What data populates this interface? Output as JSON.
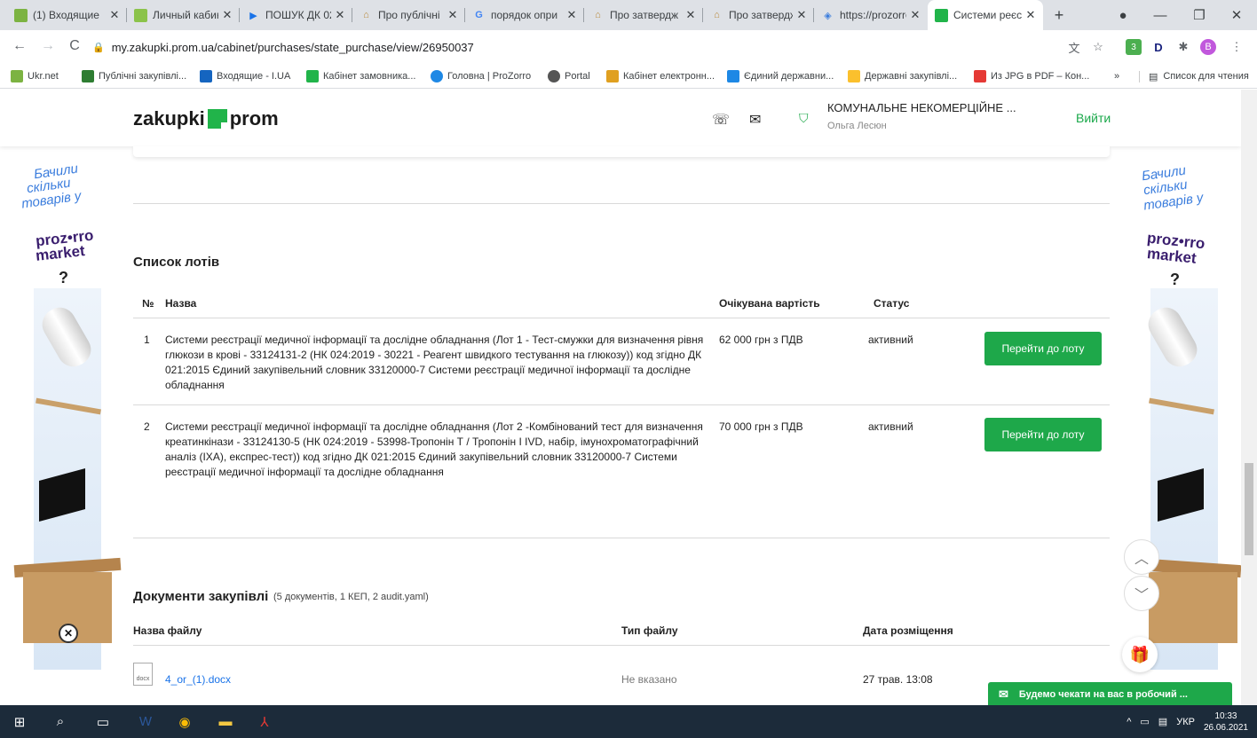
{
  "browser": {
    "tabs": [
      {
        "title": "(1) Входящие",
        "favicon_color": "#7cb342",
        "active": false
      },
      {
        "title": "Личный кабин",
        "favicon_color": "#8bc34a",
        "active": false
      },
      {
        "title": "ПОШУК ДК 02",
        "favicon_color": "#1a73e8",
        "active": false
      },
      {
        "title": "Про публічні",
        "favicon_color": "#b88a3c",
        "active": false
      },
      {
        "title": "порядок опри",
        "favicon_color": "#4285f4",
        "active": false
      },
      {
        "title": "Про затвердж",
        "favicon_color": "#b88a3c",
        "active": false
      },
      {
        "title": "Про затвердж",
        "favicon_color": "#b88a3c",
        "active": false
      },
      {
        "title": "https://prozorro",
        "favicon_color": "#3b7ddd",
        "active": false
      },
      {
        "title": "Системи реєс",
        "favicon_color": "#21b44a",
        "active": true
      }
    ],
    "url": "my.zakupki.prom.ua/cabinet/purchases/state_purchase/view/26950037",
    "profile_letter": "B",
    "bookmarks": [
      {
        "label": "Ukr.net",
        "color": "#7cb342"
      },
      {
        "label": "Публічні закупівлі...",
        "color": "#2e7d32"
      },
      {
        "label": "Входящие - I.UA",
        "color": "#1565c0"
      },
      {
        "label": "Кабінет замовника...",
        "color": "#21b44a"
      },
      {
        "label": "Головна | ProZorro",
        "color": "#1e88e5"
      },
      {
        "label": "Portal",
        "color": "#555555"
      },
      {
        "label": "Кабінет електронн...",
        "color": "#e0a020"
      },
      {
        "label": "Єдиний державни...",
        "color": "#1e88e5"
      },
      {
        "label": "Державні закупівлі...",
        "color": "#fbc02d"
      },
      {
        "label": "Из JPG в PDF – Кон...",
        "color": "#e53935"
      }
    ],
    "reading_list": "Список для чтения"
  },
  "site": {
    "logo_left": "zakupki",
    "logo_right": "prom",
    "org_name": "КОМУНАЛЬНЕ НЕКОМЕРЦІЙНЕ ...",
    "user_name": "Ольга Лесюн",
    "logout": "Вийти"
  },
  "lots": {
    "title": "Список лотів",
    "headers": {
      "num": "№",
      "name": "Назва",
      "price": "Очікувана вартість",
      "status": "Статус"
    },
    "rows": [
      {
        "num": "1",
        "name": "Системи реєстрації медичної інформації та дослідне обладнання (Лот 1 - Тест-смужки для визначення рівня глюкози в крові - 33124131-2 (НК 024:2019 - 30221 - Реагент швидкого тестування на глюкозу)) код згідно ДК 021:2015 Єдиний закупівельний словник 33120000-7 Системи реєстрації медичної інформації та дослідне обладнання",
        "price": "62 000 грн з ПДВ",
        "status": "активний",
        "button": "Перейти до лоту"
      },
      {
        "num": "2",
        "name": "Системи реєстрації медичної інформації та дослідне обладнання (Лот 2 -Комбінований тест для визначення креатинкінази - 33124130-5 (НК 024:2019 - 53998-Тропонін Т / Тропонін I IVD, набір, імунохроматографічний аналіз (ІХА), експрес-тест)) код згідно ДК 021:2015 Єдиний закупівельний словник 33120000-7 Системи реєстрації медичної інформації та дослідне обладнання",
        "price": "70 000 грн з ПДВ",
        "status": "активний",
        "button": "Перейти до лоту"
      }
    ]
  },
  "documents": {
    "title": "Документи закупівлі",
    "subtitle": "(5 документів, 1 КЕП, 2 audit.yaml)",
    "headers": {
      "file": "Назва файлу",
      "type": "Тип файлу",
      "date": "Дата розміщення"
    },
    "rows": [
      {
        "icon_label": "docx",
        "file": "4_or_(1).docx",
        "type": "Не вказано",
        "date": "27 трав. 13:08"
      }
    ]
  },
  "banner": {
    "text_line1": "Бачили",
    "text_line2": "скільки",
    "text_line3": "товарів у",
    "brand_line1": "proz•rro",
    "brand_line2": "market",
    "question": "?"
  },
  "chat": {
    "label": "Будемо чекати на вас в робочий ..."
  },
  "taskbar": {
    "lang": "УКР",
    "time": "10:33",
    "date": "26.06.2021"
  }
}
